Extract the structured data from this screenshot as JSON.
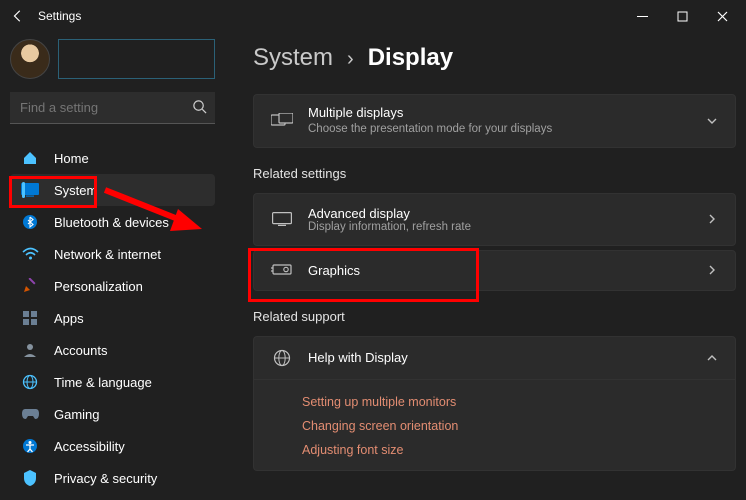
{
  "window": {
    "title": "Settings"
  },
  "search": {
    "placeholder": "Find a setting"
  },
  "sidebar": {
    "items": [
      {
        "label": "Home"
      },
      {
        "label": "System"
      },
      {
        "label": "Bluetooth & devices"
      },
      {
        "label": "Network & internet"
      },
      {
        "label": "Personalization"
      },
      {
        "label": "Apps"
      },
      {
        "label": "Accounts"
      },
      {
        "label": "Time & language"
      },
      {
        "label": "Gaming"
      },
      {
        "label": "Accessibility"
      },
      {
        "label": "Privacy & security"
      }
    ]
  },
  "breadcrumb": {
    "parent": "System",
    "current": "Display"
  },
  "cards": {
    "multiple": {
      "title": "Multiple displays",
      "sub": "Choose the presentation mode for your displays"
    }
  },
  "sections": {
    "related_settings": "Related settings",
    "related_support": "Related support"
  },
  "rows": {
    "advanced": {
      "title": "Advanced display",
      "sub": "Display information, refresh rate"
    },
    "graphics": {
      "title": "Graphics"
    },
    "help": {
      "title": "Help with Display"
    }
  },
  "help_links": [
    "Setting up multiple monitors",
    "Changing screen orientation",
    "Adjusting font size"
  ]
}
